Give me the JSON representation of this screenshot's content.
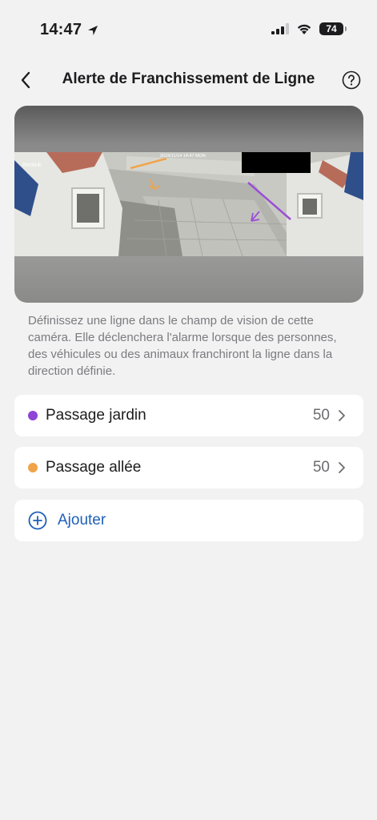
{
  "status_bar": {
    "time": "14:47",
    "battery": "74",
    "icons": [
      "location-arrow-icon",
      "signal-icon",
      "wifi-icon",
      "battery-icon"
    ]
  },
  "nav": {
    "title": "Alerte de Franchissement de Ligne",
    "back_icon": "chevron-left-icon",
    "help_icon": "question-circle-icon"
  },
  "preview": {
    "brand_watermark": "Reolink",
    "timestamp_text": "2024/11/14 14:47 MON",
    "line_colors": {
      "jardin": "#9a4fd6",
      "allee": "#f0a44a"
    }
  },
  "description": "Définissez une ligne dans le champ de vision de cette caméra. Elle déclenchera l'alarme lorsque des personnes, des véhicules ou des animaux franchiront la ligne dans la direction définie.",
  "lines": [
    {
      "label": "Passage jardin",
      "value": "50",
      "color": "#8e44d6"
    },
    {
      "label": "Passage allée",
      "value": "50",
      "color": "#f0a44a"
    }
  ],
  "add": {
    "label": "Ajouter",
    "icon": "plus-circle-icon",
    "color": "#1f5fb8"
  }
}
